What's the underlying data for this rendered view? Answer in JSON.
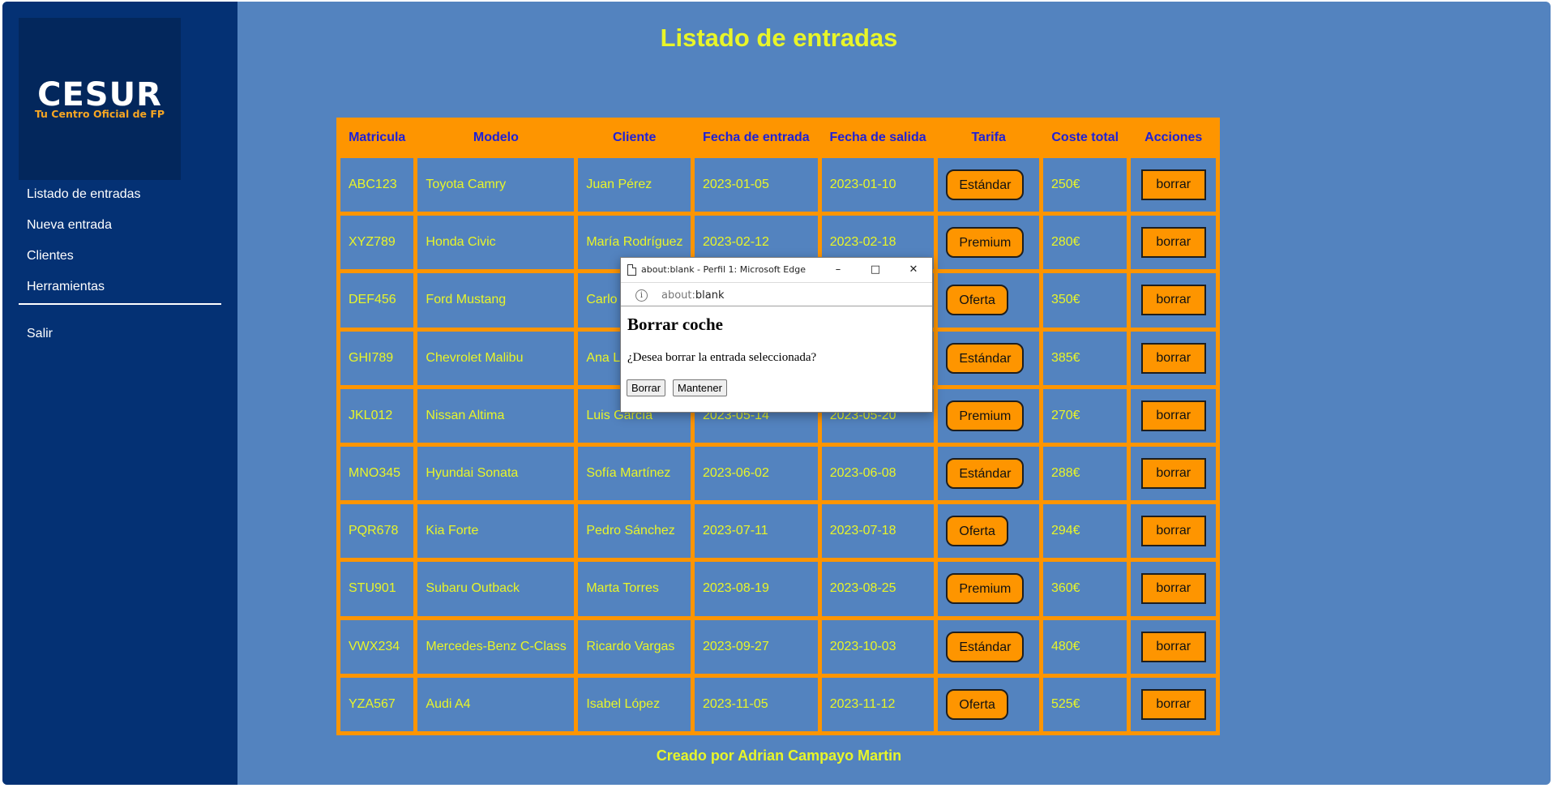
{
  "sidebar": {
    "logo": {
      "brand": "CESUR",
      "tagline": "Tu Centro Oficial de FP"
    },
    "nav": [
      {
        "label": "Listado de entradas"
      },
      {
        "label": "Nueva entrada"
      },
      {
        "label": "Clientes"
      },
      {
        "label": "Herramientas"
      }
    ],
    "logout_label": "Salir"
  },
  "main": {
    "title": "Listado de entradas",
    "footer": "Creado por Adrian Campayo Martin"
  },
  "table": {
    "headers": [
      "Matricula",
      "Modelo",
      "Cliente",
      "Fecha de entrada",
      "Fecha de salida",
      "Tarifa",
      "Coste total",
      "Acciones"
    ],
    "rows": [
      {
        "matricula": "ABC123",
        "modelo": "Toyota Camry",
        "cliente": "Juan Pérez",
        "entrada": "2023-01-05",
        "salida": "2023-01-10",
        "tarifa": "Estándar",
        "coste": "250€",
        "accion": "borrar"
      },
      {
        "matricula": "XYZ789",
        "modelo": "Honda Civic",
        "cliente": "María Rodríguez",
        "entrada": "2023-02-12",
        "salida": "2023-02-18",
        "tarifa": "Premium",
        "coste": "280€",
        "accion": "borrar"
      },
      {
        "matricula": "DEF456",
        "modelo": "Ford Mustang",
        "cliente": "Carlo",
        "entrada": "",
        "salida": "",
        "tarifa": "Oferta",
        "coste": "350€",
        "accion": "borrar"
      },
      {
        "matricula": "GHI789",
        "modelo": "Chevrolet Malibu",
        "cliente": "Ana L",
        "entrada": "",
        "salida": "",
        "tarifa": "Estándar",
        "coste": "385€",
        "accion": "borrar"
      },
      {
        "matricula": "JKL012",
        "modelo": "Nissan Altima",
        "cliente": "Luis García",
        "entrada": "2023-05-14",
        "salida": "2023-05-20",
        "tarifa": "Premium",
        "coste": "270€",
        "accion": "borrar"
      },
      {
        "matricula": "MNO345",
        "modelo": "Hyundai Sonata",
        "cliente": "Sofía Martínez",
        "entrada": "2023-06-02",
        "salida": "2023-06-08",
        "tarifa": "Estándar",
        "coste": "288€",
        "accion": "borrar"
      },
      {
        "matricula": "PQR678",
        "modelo": "Kia Forte",
        "cliente": "Pedro Sánchez",
        "entrada": "2023-07-11",
        "salida": "2023-07-18",
        "tarifa": "Oferta",
        "coste": "294€",
        "accion": "borrar"
      },
      {
        "matricula": "STU901",
        "modelo": "Subaru Outback",
        "cliente": "Marta Torres",
        "entrada": "2023-08-19",
        "salida": "2023-08-25",
        "tarifa": "Premium",
        "coste": "360€",
        "accion": "borrar"
      },
      {
        "matricula": "VWX234",
        "modelo": "Mercedes-Benz C-Class",
        "cliente": "Ricardo Vargas",
        "entrada": "2023-09-27",
        "salida": "2023-10-03",
        "tarifa": "Estándar",
        "coste": "480€",
        "accion": "borrar"
      },
      {
        "matricula": "YZA567",
        "modelo": "Audi A4",
        "cliente": "Isabel López",
        "entrada": "2023-11-05",
        "salida": "2023-11-12",
        "tarifa": "Oferta",
        "coste": "525€",
        "accion": "borrar"
      }
    ]
  },
  "popup": {
    "window_title": "about:blank - Perfil 1: Microsoft Edge",
    "minimize": "–",
    "maximize": "□",
    "close": "✕",
    "url_scheme": "about:",
    "url_rest": "blank",
    "heading": "Borrar coche",
    "message": "¿Desea borrar la entrada seleccionada?",
    "confirm_label": "Borrar",
    "cancel_label": "Mantener"
  },
  "colors": {
    "sidebar_bg": "#043174",
    "main_bg": "#5383bf",
    "accent_orange": "#fe9500",
    "text_yellow": "#e8f529",
    "header_blue": "#1f21d8"
  }
}
